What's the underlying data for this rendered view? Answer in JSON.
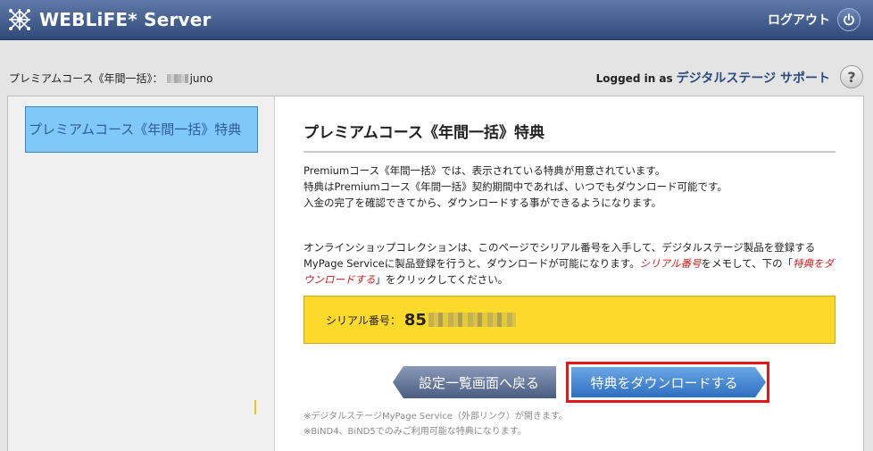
{
  "header": {
    "app_title": "WEBLiFE* Server",
    "logout_label": "ログアウト"
  },
  "subbar": {
    "course_prefix": "プレミアムコース《年間一括》：",
    "username_suffix": "juno",
    "logged_in_label": "Logged in as",
    "user_name": "デジタルステージ サポート",
    "help_label": "?"
  },
  "sidebar": {
    "items": [
      {
        "label": "プレミアムコース《年間一括》特典"
      }
    ]
  },
  "main": {
    "title": "プレミアムコース《年間一括》特典",
    "para1_lines": [
      "Premiumコース《年間一括》では、表示されている特典が用意されています。",
      "特典はPremiumコース《年間一括》契約期間中であれば、いつでもダウンロード可能です。",
      "入金の完了を確認できてから、ダウンロードする事ができるようになります。"
    ],
    "para2": {
      "text1": "オンラインショップコレクションは、このページでシリアル番号を入手して、デジタルステージ製品を登録するMyPage Serviceに製品登録を行うと、ダウンロードが可能になります。",
      "red1": "シリアル番号",
      "text2": "をメモして、下の「",
      "red2": "特典をダウンロードする",
      "text3": "」をクリックしてください。"
    },
    "serial_label": "シリアル番号：",
    "serial_visible": "85",
    "back_button": "設定一覧画面へ戻る",
    "download_button": "特典をダウンロードする",
    "notes": [
      "※デジタルステージMyPage Service（外部リンク）が開きます。",
      "※BiND4、BiND5でのみご利用可能な特典になります。"
    ]
  },
  "colors": {
    "header_bg": "#3b5687",
    "sidebar_active": "#7fc8f8",
    "serial_bg": "#fcd92b",
    "highlight_border": "#e01818",
    "download_btn": "#2e6fc0",
    "back_btn": "#4a5d82"
  }
}
